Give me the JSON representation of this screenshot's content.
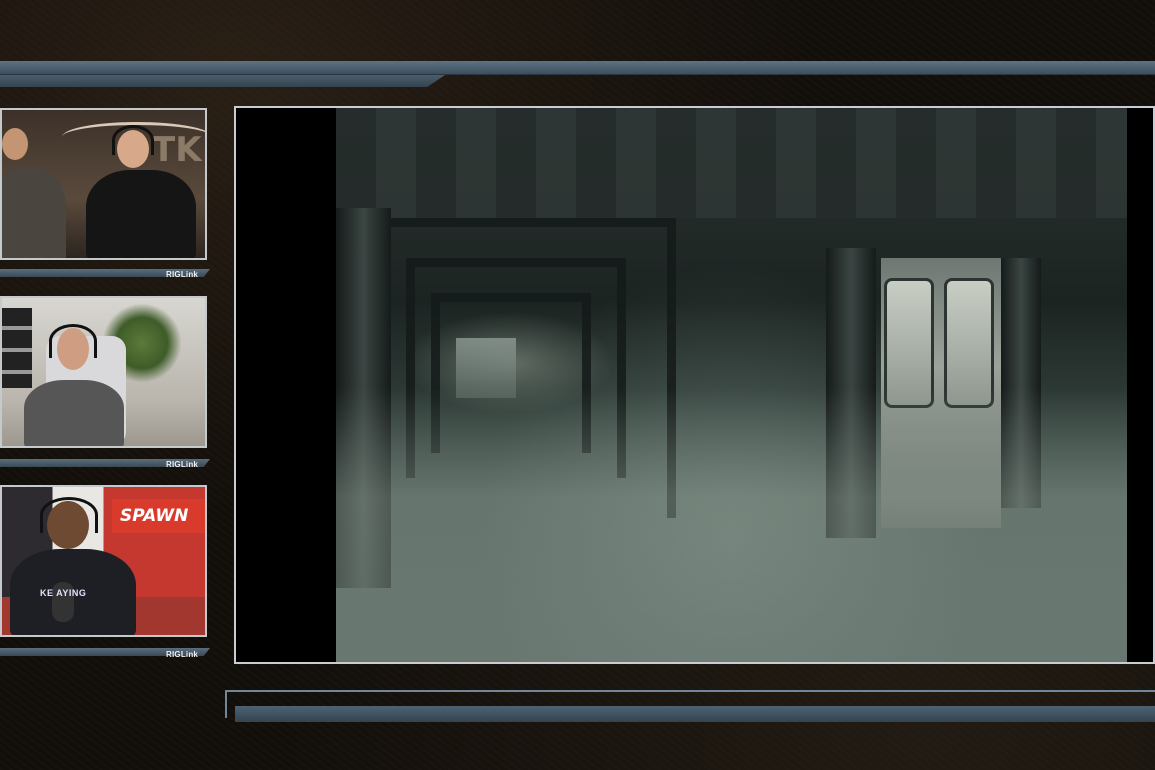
{
  "overlay": {
    "accent_color": "#4d6273",
    "frame_color": "#c9cdd1"
  },
  "cameras": [
    {
      "label": "RIGLink",
      "description_icon": "two-hosts-video"
    },
    {
      "label": "RIGLink",
      "description_icon": "host-video"
    },
    {
      "label": "RIGLink",
      "description_icon": "host-video",
      "background_sign": "SPAWN",
      "shirt_text": "KE  AYING"
    }
  ],
  "main_view": {
    "content_icon": "sci-fi-corridor-gameplay"
  }
}
